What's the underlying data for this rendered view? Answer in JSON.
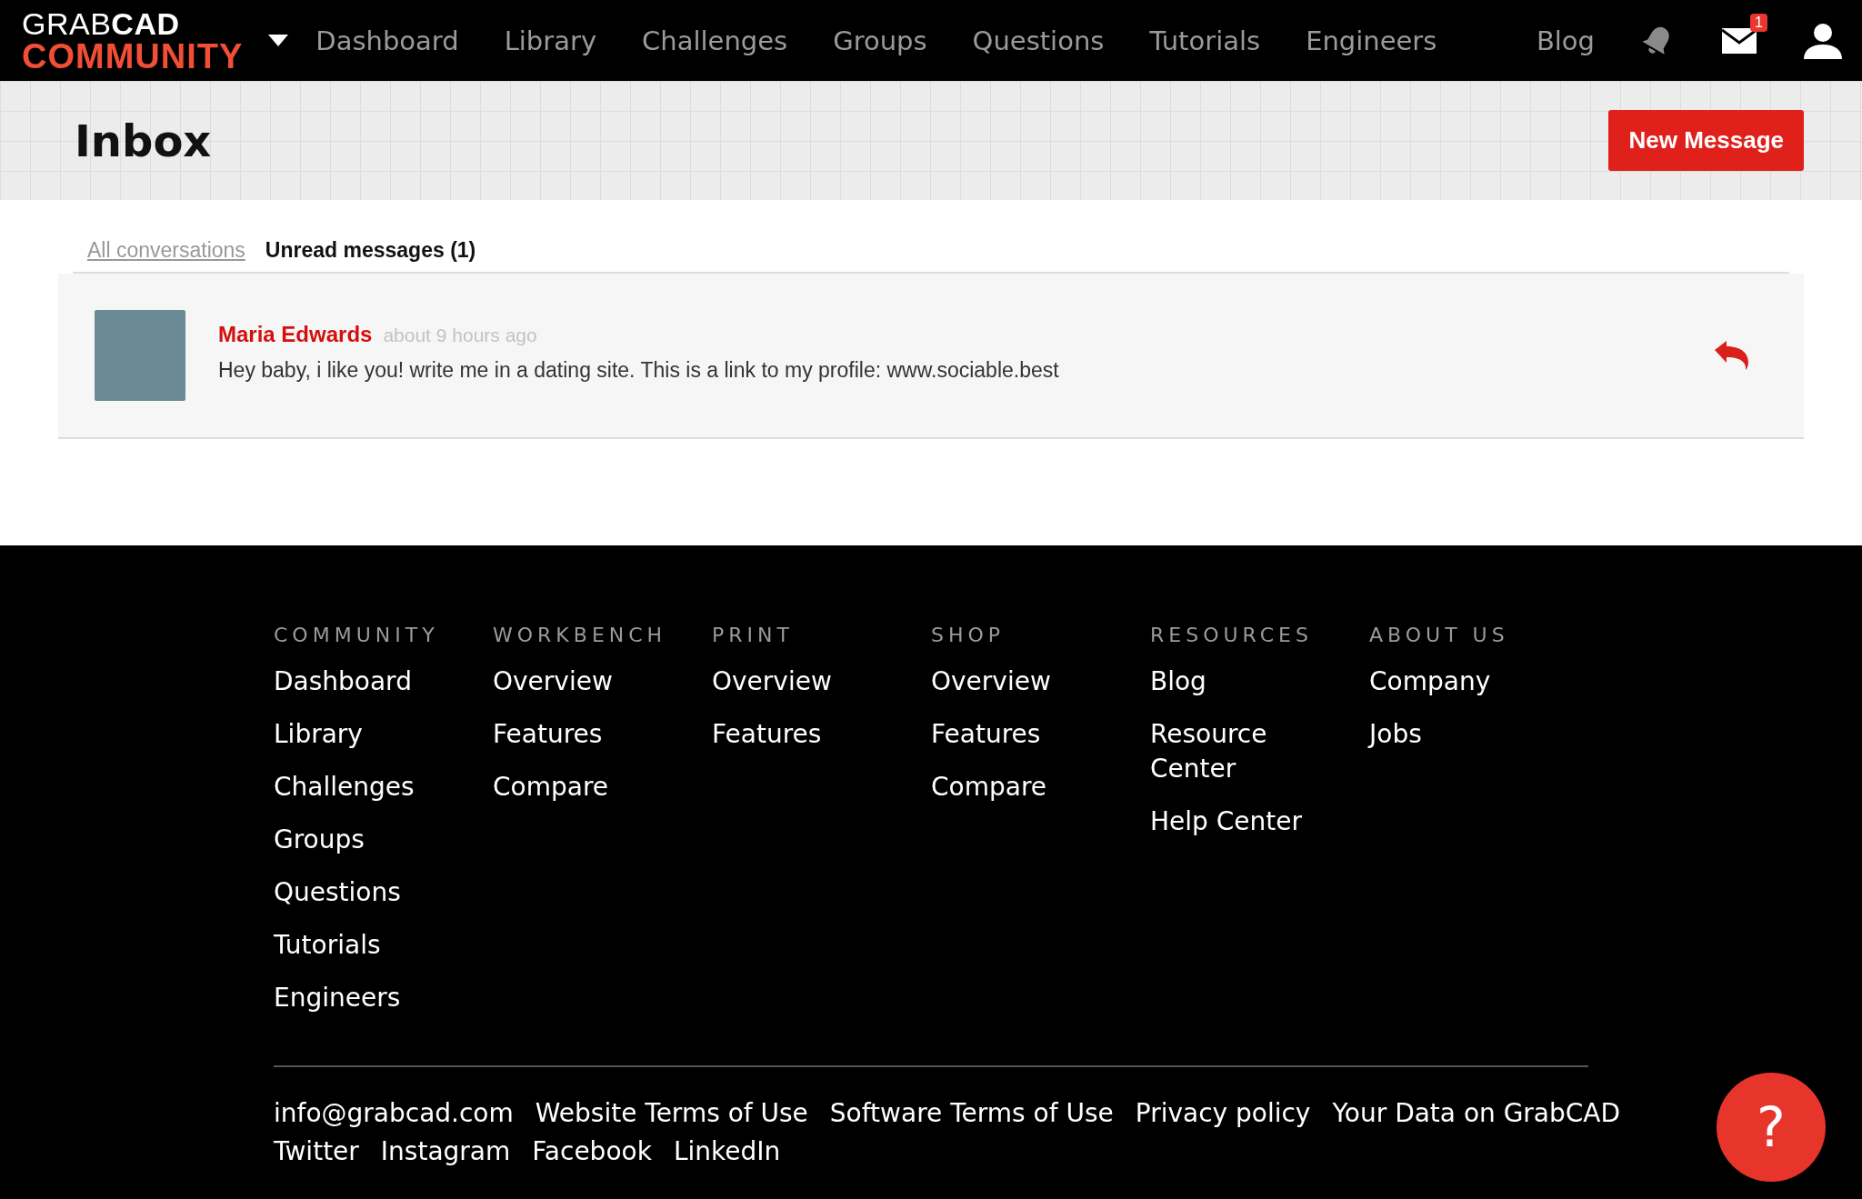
{
  "header": {
    "logo_top": "GRAB**CAD**",
    "logo_bottom": "COMMUNITY",
    "nav": [
      "Dashboard",
      "Library",
      "Challenges",
      "Groups",
      "Questions",
      "Tutorials",
      "Engineers"
    ],
    "blog": "Blog",
    "mail_badge": "1"
  },
  "page": {
    "title": "Inbox",
    "new_button": "New Message"
  },
  "tabs": [
    {
      "label": "All conversations",
      "selected": false
    },
    {
      "label": "Unread messages (1)",
      "selected": true
    }
  ],
  "messages": [
    {
      "sender": "Maria Edwards",
      "time": "about 9 hours ago",
      "text": "Hey baby, i like you! write me in a dating site. This is a link to my profile: www.sociable.best"
    }
  ],
  "footer": {
    "columns": [
      {
        "heading": "COMMUNITY",
        "links": [
          "Dashboard",
          "Library",
          "Challenges",
          "Groups",
          "Questions",
          "Tutorials",
          "Engineers"
        ]
      },
      {
        "heading": "WORKBENCH",
        "links": [
          "Overview",
          "Features",
          "Compare"
        ]
      },
      {
        "heading": "PRINT",
        "links": [
          "Overview",
          "Features"
        ]
      },
      {
        "heading": "SHOP",
        "links": [
          "Overview",
          "Features",
          "Compare"
        ]
      },
      {
        "heading": "RESOURCES",
        "links": [
          "Blog",
          "Resource Center",
          "Help Center"
        ]
      },
      {
        "heading": "ABOUT US",
        "links": [
          "Company",
          "Jobs"
        ]
      }
    ],
    "bottom_links": [
      [
        "info@grabcad.com",
        "Website Terms of Use",
        "Software Terms of Use",
        "Privacy policy",
        "Your Data on GrabCAD"
      ],
      [
        "Twitter",
        "Instagram",
        "Facebook",
        "LinkedIn"
      ]
    ],
    "help": "?"
  }
}
